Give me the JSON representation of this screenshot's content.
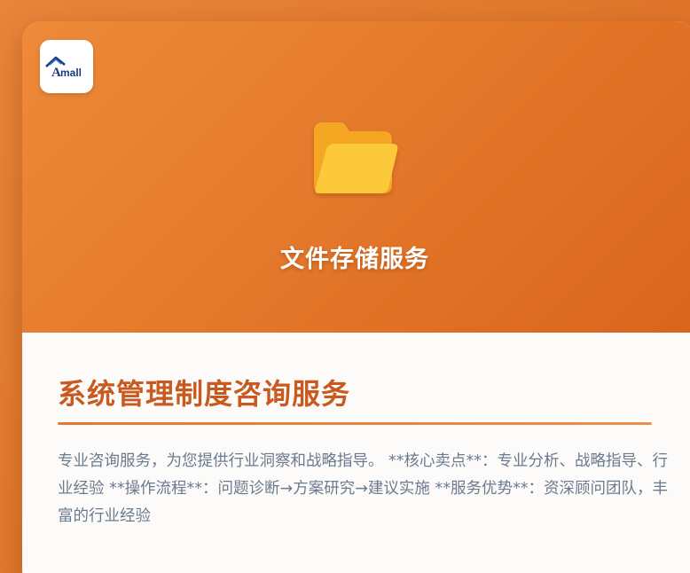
{
  "logo": {
    "text": "Amall",
    "name": "amall-logo"
  },
  "hero": {
    "icon": "folder-icon",
    "title": "文件存储服务"
  },
  "service": {
    "title": "系统管理制度咨询服务",
    "description": "专业咨询服务，为您提供行业洞察和战略指导。 **核心卖点**：专业分析、战略指导、行业经验 **操作流程**：问题诊断→方案研究→建议实施 **服务优势**：资深顾问团队，丰富的行业经验"
  },
  "colors": {
    "accent": "#e27a2e",
    "title": "#c85a1f",
    "text": "#6b7b8f",
    "folder_back": "#f5a623",
    "folder_front": "#fbc93a"
  }
}
